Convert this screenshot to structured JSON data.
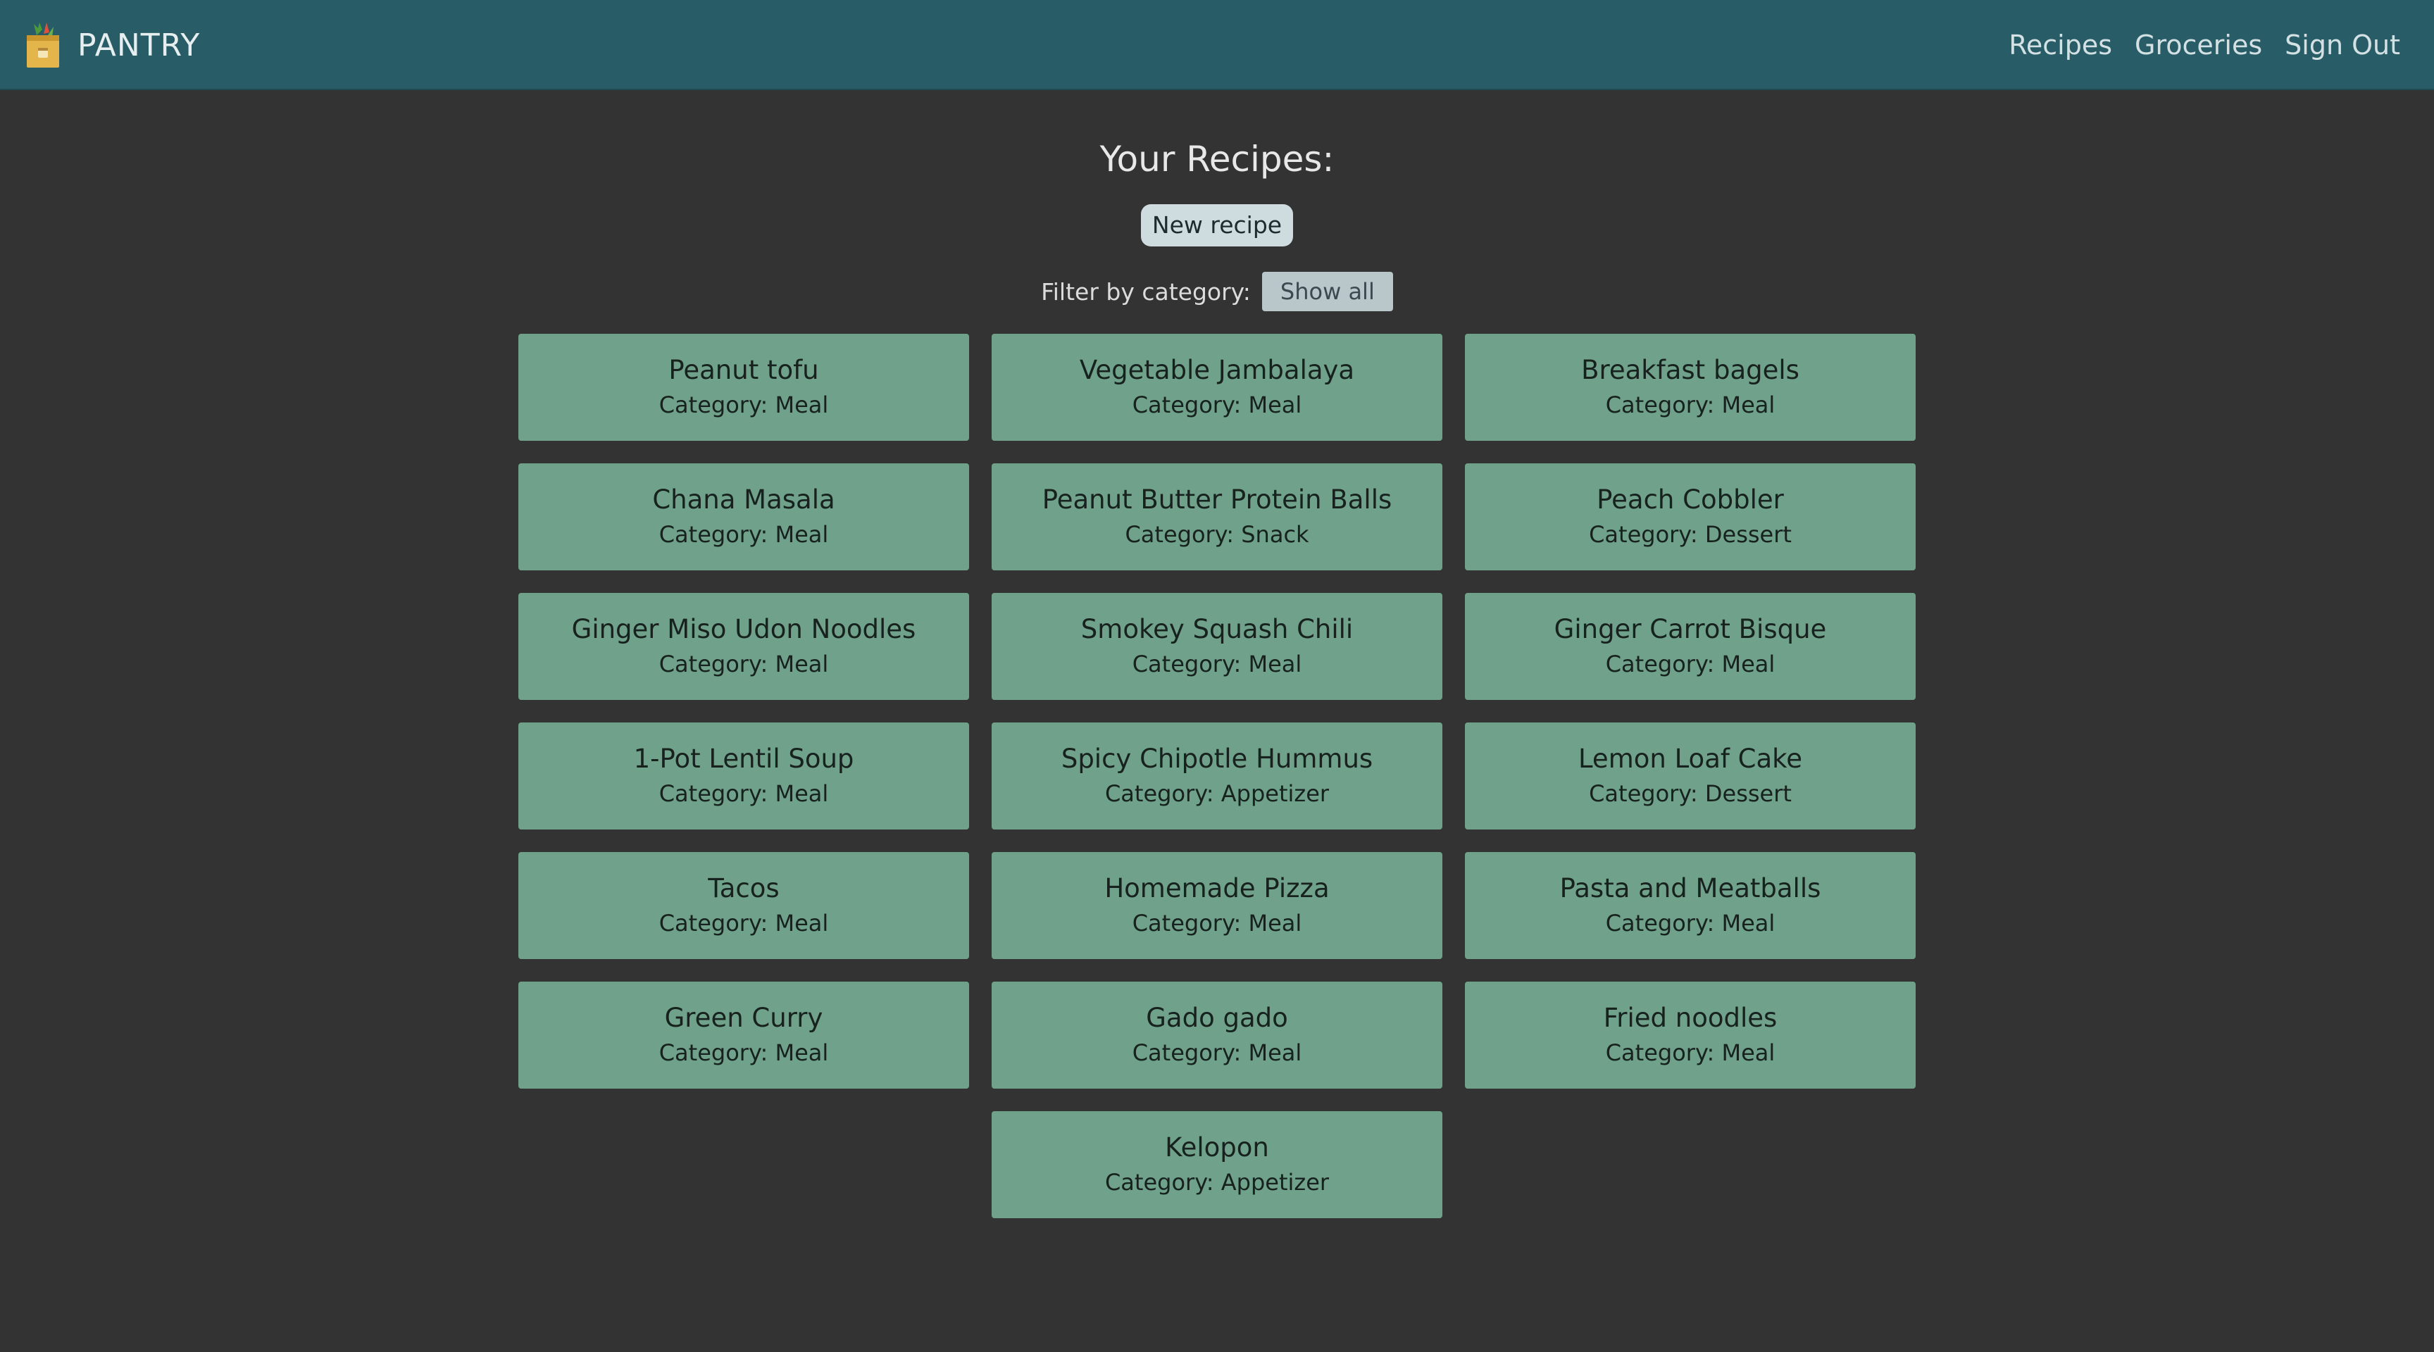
{
  "header": {
    "brand_name": "PANTRY",
    "brand_icon": "grocery-bag-icon",
    "nav": [
      {
        "label": "Recipes"
      },
      {
        "label": "Groceries"
      },
      {
        "label": "Sign Out"
      }
    ]
  },
  "main": {
    "title": "Your Recipes:",
    "new_recipe_label": "New recipe",
    "filter_label": "Filter by category:",
    "filter_value": "Show all",
    "category_prefix": "Category: ",
    "recipes": [
      {
        "name": "Peanut tofu",
        "category": "Meal"
      },
      {
        "name": "Vegetable Jambalaya",
        "category": "Meal"
      },
      {
        "name": "Breakfast bagels",
        "category": "Meal"
      },
      {
        "name": "Chana Masala",
        "category": "Meal"
      },
      {
        "name": "Peanut Butter Protein Balls",
        "category": "Snack"
      },
      {
        "name": "Peach Cobbler",
        "category": "Dessert"
      },
      {
        "name": "Ginger Miso Udon Noodles",
        "category": "Meal"
      },
      {
        "name": "Smokey Squash Chili",
        "category": "Meal"
      },
      {
        "name": "Ginger Carrot Bisque",
        "category": "Meal"
      },
      {
        "name": "1-Pot Lentil Soup",
        "category": "Meal"
      },
      {
        "name": "Spicy Chipotle Hummus",
        "category": "Appetizer"
      },
      {
        "name": "Lemon Loaf Cake",
        "category": "Dessert"
      },
      {
        "name": "Tacos",
        "category": "Meal"
      },
      {
        "name": "Homemade Pizza",
        "category": "Meal"
      },
      {
        "name": "Pasta and Meatballs",
        "category": "Meal"
      },
      {
        "name": "Green Curry",
        "category": "Meal"
      },
      {
        "name": "Gado gado",
        "category": "Meal"
      },
      {
        "name": "Fried noodles",
        "category": "Meal"
      },
      {
        "name": "Kelopon",
        "category": "Appetizer"
      }
    ]
  },
  "colors": {
    "navbar": "#285d68",
    "background": "#333333",
    "card": "#6fa18b",
    "button": "#cfdcdf"
  }
}
